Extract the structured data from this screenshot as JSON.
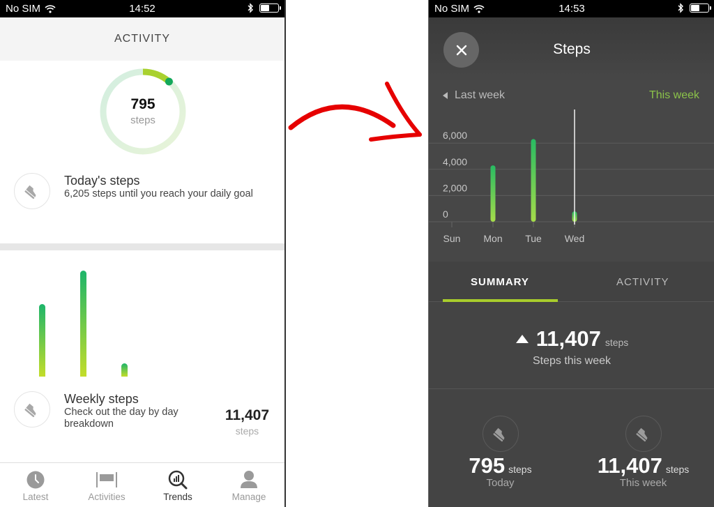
{
  "left_screen": {
    "status_bar": {
      "carrier": "No SIM",
      "time": "14:52"
    },
    "header": {
      "title": "ACTIVITY"
    },
    "ring": {
      "value": "795",
      "unit": "steps",
      "progress_fraction": 0.114
    },
    "today_steps": {
      "title": "Today's steps",
      "subtitle": "6,205 steps until you reach your daily goal"
    },
    "weekly_steps": {
      "title": "Weekly steps",
      "subtitle": "Check out the day by day breakdown",
      "total": "11,407",
      "unit": "steps"
    },
    "tab_bar": {
      "items": [
        {
          "label": "Latest",
          "icon": "clock-icon",
          "active": false
        },
        {
          "label": "Activities",
          "icon": "activities-icon",
          "active": false
        },
        {
          "label": "Trends",
          "icon": "trends-icon",
          "active": true
        },
        {
          "label": "Manage",
          "icon": "person-icon",
          "active": false
        }
      ]
    }
  },
  "right_screen": {
    "status_bar": {
      "carrier": "No SIM",
      "time": "14:53"
    },
    "header": {
      "title": "Steps"
    },
    "week_nav": {
      "previous": "Last week",
      "current": "This week"
    },
    "tabs": {
      "summary": "SUMMARY",
      "activity": "ACTIVITY",
      "active": "summary"
    },
    "summary": {
      "total": "11,407",
      "unit": "steps",
      "caption": "Steps this week",
      "trend": "up"
    },
    "stats": [
      {
        "value": "795",
        "unit": "steps",
        "caption": "Today"
      },
      {
        "value": "11,407",
        "unit": "steps",
        "caption": "This week"
      }
    ]
  },
  "colors": {
    "accent_green": "#8bc34a",
    "bar_top": "#1db56a",
    "bar_bottom": "#c3dd2a",
    "tab_underline": "#a8cc2c",
    "arrow_red": "#e60000"
  },
  "chart_data": {
    "type": "bar",
    "title": "Steps",
    "categories": [
      "Sun",
      "Mon",
      "Tue",
      "Wed"
    ],
    "values": [
      0,
      4300,
      6312,
      795
    ],
    "ytick_labels": [
      "0",
      "2,000",
      "4,000",
      "6,000"
    ],
    "yticks": [
      0,
      2000,
      4000,
      6000
    ],
    "ylim": [
      0,
      7000
    ],
    "xlabel": "",
    "ylabel": "",
    "grid": true,
    "current_day": "Wed"
  }
}
